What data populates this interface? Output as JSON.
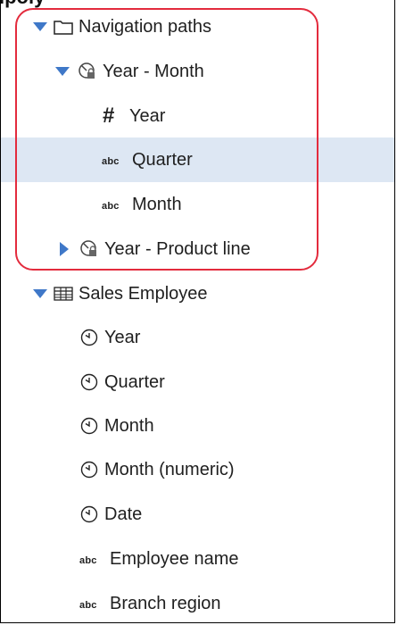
{
  "header_fragment": "lpoly",
  "tree": {
    "items": [
      {
        "label": "Navigation paths",
        "icon": "folder-icon",
        "twisty": "expanded"
      },
      {
        "label": "Year - Month",
        "icon": "navigation-path-lock-icon",
        "twisty": "expanded"
      },
      {
        "label": "Year",
        "icon": "hash-icon"
      },
      {
        "label": "Quarter",
        "icon": "abc-icon",
        "selected": true
      },
      {
        "label": "Month",
        "icon": "abc-icon"
      },
      {
        "label": "Year - Product line",
        "icon": "navigation-path-lock-icon",
        "twisty": "collapsed"
      },
      {
        "label": "Sales Employee",
        "icon": "table-icon",
        "twisty": "expanded"
      },
      {
        "label": "Year",
        "icon": "clock-icon"
      },
      {
        "label": "Quarter",
        "icon": "clock-icon"
      },
      {
        "label": "Month",
        "icon": "clock-icon"
      },
      {
        "label": "Month (numeric)",
        "icon": "clock-icon"
      },
      {
        "label": "Date",
        "icon": "clock-icon"
      },
      {
        "label": "Employee name",
        "icon": "abc-icon"
      },
      {
        "label": "Branch region",
        "icon": "abc-icon"
      }
    ],
    "abc_text": "abc",
    "hash_text": "#"
  },
  "colors": {
    "selection": "#dde7f3",
    "twisty": "#3f78c8",
    "highlight": "#e32b3d"
  }
}
